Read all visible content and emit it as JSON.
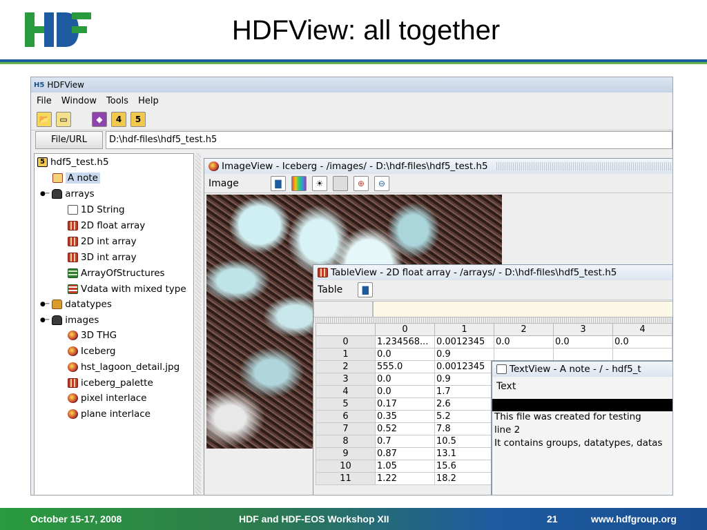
{
  "slide": {
    "title": "HDFView: all together",
    "footer_date": "October 15-17, 2008",
    "footer_event": "HDF and HDF-EOS Workshop XII",
    "footer_page": "21",
    "footer_url": "www.hdfgroup.org",
    "colors": {
      "rule_blue": "#1a5e9c",
      "rule_green": "#6ab04c"
    }
  },
  "app": {
    "window_title": "HDFView",
    "menu": [
      "File",
      "Window",
      "Tools",
      "Help"
    ],
    "url_button": "File/URL",
    "url_value": "D:\\hdf-files\\hdf5_test.h5"
  },
  "tree": {
    "root": "hdf5_test.h5",
    "items": [
      {
        "label": "A note",
        "icon": "note-icon"
      },
      {
        "label": "arrays",
        "icon": "folder-open-icon"
      },
      {
        "label": "1D String",
        "icon": "text-icon"
      },
      {
        "label": "2D float array",
        "icon": "grid-icon"
      },
      {
        "label": "2D int array",
        "icon": "grid-icon"
      },
      {
        "label": "3D int array",
        "icon": "grid-icon"
      },
      {
        "label": "ArrayOfStructures",
        "icon": "struct-icon"
      },
      {
        "label": "Vdata with mixed type",
        "icon": "vdata-icon"
      },
      {
        "label": "datatypes",
        "icon": "folder-icon"
      },
      {
        "label": "images",
        "icon": "folder-open-icon"
      },
      {
        "label": "3D THG",
        "icon": "image-icon"
      },
      {
        "label": "Iceberg",
        "icon": "image-icon"
      },
      {
        "label": "hst_lagoon_detail.jpg",
        "icon": "image-icon"
      },
      {
        "label": "iceberg_palette",
        "icon": "grid-icon"
      },
      {
        "label": "pixel interlace",
        "icon": "image-icon"
      },
      {
        "label": "plane interlace",
        "icon": "image-icon"
      }
    ]
  },
  "imageview": {
    "title": "ImageView  -  Iceberg  -  /images/  -  D:\\hdf-files\\hdf5_test.h5",
    "menu": "Image"
  },
  "tableview": {
    "title": "TableView  -  2D float array  -  /arrays/  -  D:\\hdf-files\\hdf5_test.h5",
    "menu": "Table",
    "columns": [
      "0",
      "1",
      "2",
      "3",
      "4"
    ],
    "rows": [
      {
        "index": "0",
        "cells": [
          "1.234568...",
          "0.0012345",
          "0.0",
          "0.0",
          "0.0"
        ]
      },
      {
        "index": "1",
        "cells": [
          "0.0",
          "0.9",
          "",
          "",
          ""
        ]
      },
      {
        "index": "2",
        "cells": [
          "555.0",
          "0.0012345",
          "",
          "",
          ""
        ]
      },
      {
        "index": "3",
        "cells": [
          "0.0",
          "0.9",
          "",
          "",
          ""
        ]
      },
      {
        "index": "4",
        "cells": [
          "0.0",
          "1.7",
          "",
          "",
          ""
        ]
      },
      {
        "index": "5",
        "cells": [
          "0.17",
          "2.6",
          "",
          "",
          ""
        ]
      },
      {
        "index": "6",
        "cells": [
          "0.35",
          "5.2",
          "",
          "",
          ""
        ]
      },
      {
        "index": "7",
        "cells": [
          "0.52",
          "7.8",
          "",
          "",
          ""
        ]
      },
      {
        "index": "8",
        "cells": [
          "0.7",
          "10.5",
          "",
          "",
          ""
        ]
      },
      {
        "index": "9",
        "cells": [
          "0.87",
          "13.1",
          "",
          "",
          ""
        ]
      },
      {
        "index": "10",
        "cells": [
          "1.05",
          "15.6",
          "",
          "",
          ""
        ]
      },
      {
        "index": "11",
        "cells": [
          "1.22",
          "18.2",
          "",
          "",
          ""
        ]
      }
    ]
  },
  "textview": {
    "title": "TextView  -  A note  -  /  -  hdf5_t",
    "menu": "Text",
    "lines": [
      "This file was created for testing",
      "line 2",
      "It contains groups, datatypes, datas"
    ]
  }
}
